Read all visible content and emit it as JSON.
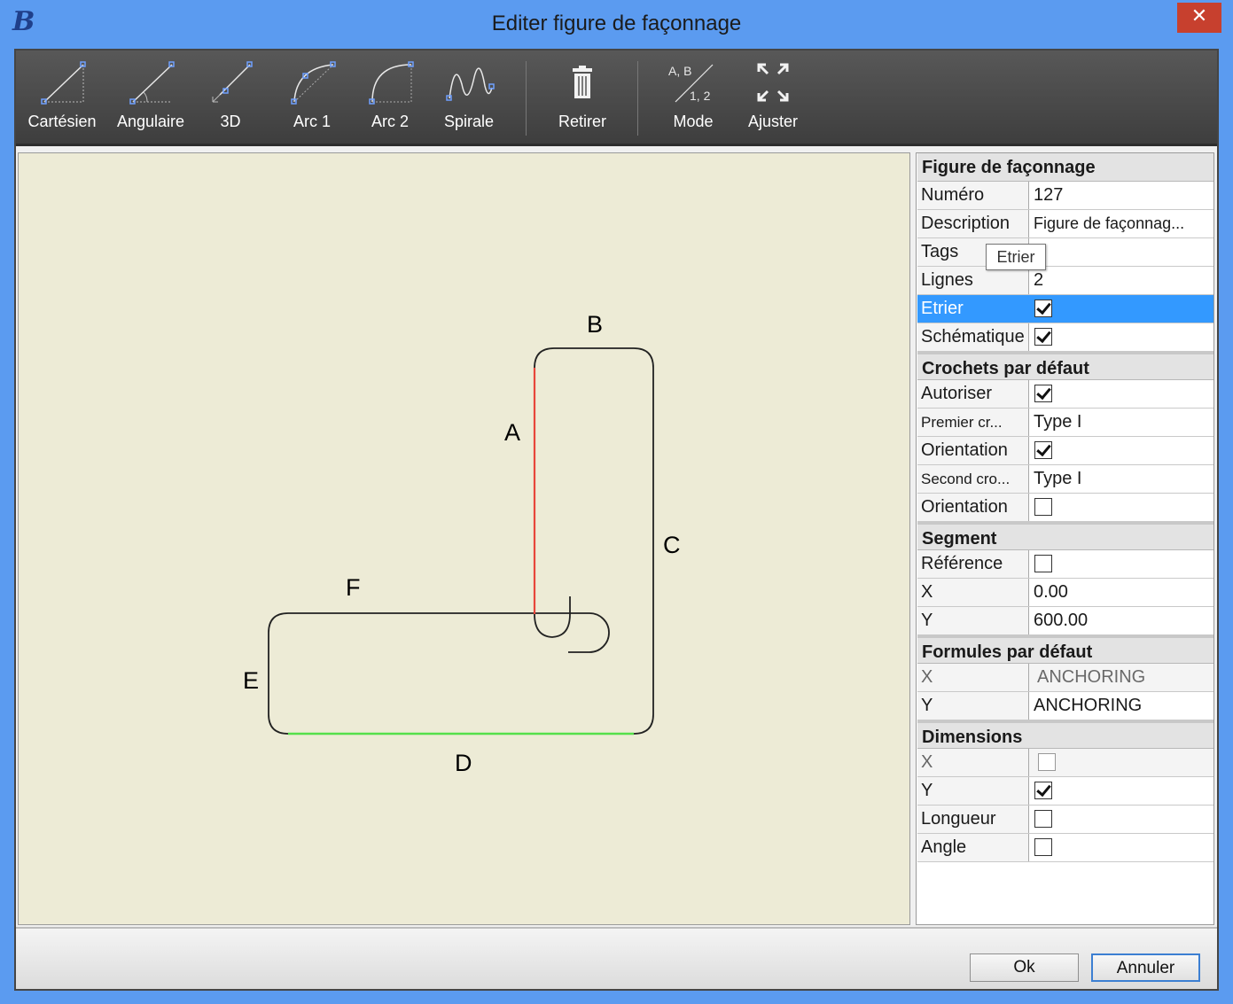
{
  "window": {
    "title": "Editer figure de façonnage",
    "app_icon": "B",
    "close_glyph": "✕"
  },
  "toolbar": {
    "cartesien": "Cartésien",
    "angulaire": "Angulaire",
    "3d": "3D",
    "arc1": "Arc 1",
    "arc2": "Arc 2",
    "spirale": "Spirale",
    "retirer": "Retirer",
    "mode": "Mode",
    "mode_icon_top": "A, B",
    "mode_icon_bottom": "1, 2",
    "ajuster": "Ajuster"
  },
  "shape": {
    "labels": {
      "A": "A",
      "B": "B",
      "C": "C",
      "D": "D",
      "E": "E",
      "F": "F"
    },
    "highlight_colors": {
      "A": "#e8463a",
      "D": "#55e04a"
    },
    "line_color": "#222222"
  },
  "props": {
    "figure": {
      "header": "Figure de façonnage",
      "numero": {
        "label": "Numéro",
        "value": "127"
      },
      "description": {
        "label": "Description",
        "value": "Figure de façonnag..."
      },
      "tags": {
        "label": "Tags",
        "value": ""
      },
      "lignes": {
        "label": "Lignes",
        "value": "2"
      },
      "etrier": {
        "label": "Etrier",
        "checked": true
      },
      "schematique": {
        "label": "Schématique",
        "checked": true
      }
    },
    "crochets": {
      "header": "Crochets par défaut",
      "autoriser": {
        "label": "Autoriser",
        "checked": true
      },
      "premier": {
        "label": "Premier cr...",
        "value": "Type I"
      },
      "orientation1": {
        "label": "Orientation",
        "checked": true
      },
      "second": {
        "label": "Second cro...",
        "value": "Type I"
      },
      "orientation2": {
        "label": "Orientation",
        "checked": false
      }
    },
    "segment": {
      "header": "Segment",
      "reference": {
        "label": "Référence",
        "checked": false
      },
      "x": {
        "label": "X",
        "value": "0.00"
      },
      "y": {
        "label": "Y",
        "value": "600.00"
      }
    },
    "formules": {
      "header": "Formules par défaut",
      "x": {
        "label": "X",
        "value": "ANCHORING"
      },
      "y": {
        "label": "Y",
        "value": "ANCHORING"
      }
    },
    "dimensions": {
      "header": "Dimensions",
      "x": {
        "label": "X",
        "checked": false
      },
      "y": {
        "label": "Y",
        "checked": true
      },
      "longueur": {
        "label": "Longueur",
        "checked": false
      },
      "angle": {
        "label": "Angle",
        "checked": false
      }
    }
  },
  "tooltip": "Etrier",
  "buttons": {
    "ok": "Ok",
    "annuler": "Annuler"
  }
}
